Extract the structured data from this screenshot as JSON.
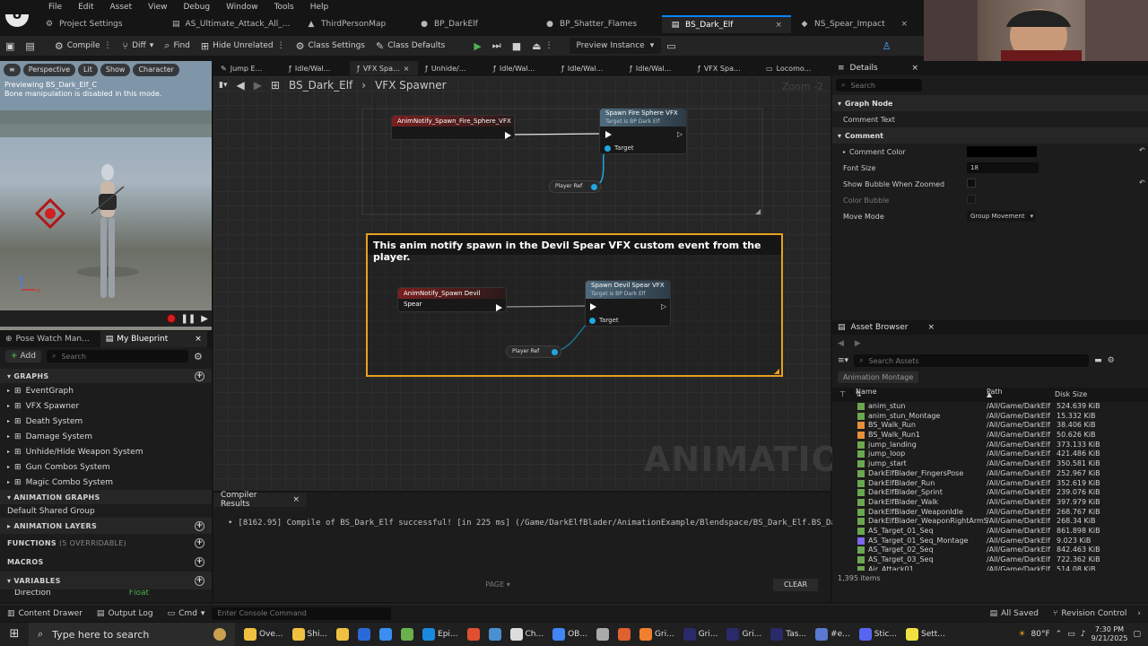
{
  "menu": [
    "File",
    "Edit",
    "Asset",
    "View",
    "Debug",
    "Window",
    "Tools",
    "Help"
  ],
  "tabs": [
    {
      "label": "Project Settings",
      "icon": "⚙"
    },
    {
      "label": "AS_Ultimate_Attack_All_...",
      "icon": "▤"
    },
    {
      "label": "ThirdPersonMap",
      "icon": "▲"
    },
    {
      "label": "BP_DarkElf",
      "icon": "●"
    },
    {
      "label": "BP_Shatter_Flames",
      "icon": "●"
    },
    {
      "label": "BS_Dark_Elf",
      "icon": "▤",
      "active": true
    },
    {
      "label": "NS_Spear_Impact",
      "icon": "◆"
    }
  ],
  "toolbar": {
    "compile": "Compile",
    "diff": "Diff",
    "find": "Find",
    "hide_unrelated": "Hide Unrelated",
    "class_settings": "Class Settings",
    "class_defaults": "Class Defaults",
    "preview_instance": "Preview Instance"
  },
  "viewport": {
    "pills": [
      "Perspective",
      "Lit",
      "Show",
      "Character"
    ],
    "info_line1": "Previewing BS_Dark_Elf_C",
    "info_line2": "Bone manipulation is disabled in this mode."
  },
  "left_panel": {
    "tabs": [
      "Pose Watch Man...",
      "My Blueprint"
    ],
    "add_label": "Add",
    "search_placeholder": "Search",
    "graphs_header": "GRAPHS",
    "graphs": [
      "EventGraph",
      "VFX Spawner",
      "Death System",
      "Damage System",
      "Unhide/Hide Weapon System",
      "Gun Combos System",
      "Magic Combo System"
    ],
    "animation_graphs_header": "ANIMATION GRAPHS",
    "animation_graph_item": "Default Shared Group",
    "animation_layers_header": "ANIMATION LAYERS",
    "functions_header": "FUNCTIONS",
    "functions_note": "(5 OVERRIDABLE)",
    "macros_header": "MACROS",
    "variables_header": "VARIABLES",
    "var_partial_name": "Direction",
    "var_partial_type": "Float"
  },
  "graph_tabs": [
    "Jump E...",
    "Idle/Wal...",
    "VFX Spa...",
    "Unhide/...",
    "Idle/Wal...",
    "Idle/Wal...",
    "Idle/Wal...",
    "VFX Spa...",
    "Locomo..."
  ],
  "breadcrumb": {
    "root": "BS_Dark_Elf",
    "current": "VFX Spawner"
  },
  "zoom": "Zoom -2",
  "nodes": {
    "notify1": "AnimNotify_Spawn_Fire_Sphere_VFX",
    "func1": "Spawn Fire Sphere VFX",
    "func1_sub": "Target is BP Dark Elf",
    "target1": "Target",
    "var1": "Player Ref",
    "comment": "This anim notify spawn in the Devil Spear VFX custom event from the player.",
    "notify2": "AnimNotify_Spawn Devil Spear",
    "func2": "Spawn Devil Spear VFX",
    "func2_sub": "Target is BP Dark Elf",
    "target2": "Target",
    "var2": "Player Ref"
  },
  "watermark": "ANIMATION",
  "compiler": {
    "tab": "Compiler Results",
    "message": "[8162.95] Compile of BS_Dark_Elf successful! [in 225 ms] (/Game/DarkElfBlader/AnimationExample/Blendspace/BS_Dark_Elf.BS_Dark_Elf)",
    "page": "PAGE",
    "clear": "CLEAR"
  },
  "details": {
    "title": "Details",
    "search_placeholder": "Search",
    "graph_node_cat": "Graph Node",
    "comment_text_label": "Comment Text",
    "comment_cat": "Comment",
    "comment_color_label": "Comment Color",
    "font_size_label": "Font Size",
    "font_size_value": "18",
    "show_bubble_label": "Show Bubble When Zoomed",
    "color_bubble_label": "Color Bubble",
    "move_mode_label": "Move Mode",
    "move_mode_value": "Group Movement"
  },
  "asset_browser": {
    "title": "Asset Browser",
    "search_placeholder": "Search Assets",
    "filter_chip": "Animation Montage",
    "col_name": "Name",
    "col_path": "Path",
    "col_size": "Disk Size",
    "rows": [
      {
        "name": "anim_stun",
        "path": "/All/Game/DarkElf",
        "size": "524.639 KiB",
        "color": "#6aa84f"
      },
      {
        "name": "anim_stun_Montage",
        "path": "/All/Game/DarkElf",
        "size": "15.332 KiB",
        "color": "#6aa84f"
      },
      {
        "name": "BS_Walk_Run",
        "path": "/All/Game/DarkElf",
        "size": "38.406 KiB",
        "color": "#e69138"
      },
      {
        "name": "BS_Walk_Run1",
        "path": "/All/Game/DarkElf",
        "size": "50.626 KiB",
        "color": "#e69138"
      },
      {
        "name": "jump_landing",
        "path": "/All/Game/DarkElf",
        "size": "373.133 KiB",
        "color": "#6aa84f"
      },
      {
        "name": "jump_loop",
        "path": "/All/Game/DarkElf",
        "size": "421.486 KiB",
        "color": "#6aa84f"
      },
      {
        "name": "jump_start",
        "path": "/All/Game/DarkElf",
        "size": "350.581 KiB",
        "color": "#6aa84f"
      },
      {
        "name": "DarkElfBlader_FingersPose",
        "path": "/All/Game/DarkElf",
        "size": "252.967 KiB",
        "color": "#6aa84f"
      },
      {
        "name": "DarkElfBlader_Run",
        "path": "/All/Game/DarkElf",
        "size": "352.619 KiB",
        "color": "#6aa84f"
      },
      {
        "name": "DarkElfBlader_Sprint",
        "path": "/All/Game/DarkElf",
        "size": "239.076 KiB",
        "color": "#6aa84f"
      },
      {
        "name": "DarkElfBlader_Walk",
        "path": "/All/Game/DarkElf",
        "size": "397.979 KiB",
        "color": "#6aa84f"
      },
      {
        "name": "DarkElfBlader_WeaponIdle",
        "path": "/All/Game/DarkElf",
        "size": "268.767 KiB",
        "color": "#6aa84f"
      },
      {
        "name": "DarkElfBlader_WeaponRightArmS",
        "path": "/All/Game/DarkElf",
        "size": "268.34 KiB",
        "color": "#6aa84f"
      },
      {
        "name": "AS_Target_01_Seq",
        "path": "/All/Game/DarkElf",
        "size": "861.898 KiB",
        "color": "#6aa84f"
      },
      {
        "name": "AS_Target_01_Seq_Montage",
        "path": "/All/Game/DarkElf",
        "size": "9.023 KiB",
        "color": "#7b68ee"
      },
      {
        "name": "AS_Target_02_Seq",
        "path": "/All/Game/DarkElf",
        "size": "842.463 KiB",
        "color": "#6aa84f"
      },
      {
        "name": "AS_Target_03_Seq",
        "path": "/All/Game/DarkElf",
        "size": "722.362 KiB",
        "color": "#6aa84f"
      },
      {
        "name": "Air_Attack01",
        "path": "/All/Game/DarkElf",
        "size": "514.08 KiB",
        "color": "#6aa84f"
      }
    ],
    "count": "1,395 items"
  },
  "statusbar": {
    "content_drawer": "Content Drawer",
    "output_log": "Output Log",
    "cmd": "Cmd",
    "console_placeholder": "Enter Console Command",
    "all_saved": "All Saved",
    "revision_control": "Revision Control"
  },
  "taskbar": {
    "search_placeholder": "Type here to search",
    "apps": [
      "Ove...",
      "Shi...",
      "",
      "",
      "",
      "",
      "Epi...",
      "",
      "",
      "Ch...",
      "OB...",
      "",
      "",
      "Gri...",
      "Gri...",
      "Gri...",
      "Tas...",
      "#e...",
      "Stic...",
      "Sett..."
    ],
    "weather": "80°F",
    "time": "7:30 PM",
    "date": "9/21/2025"
  }
}
